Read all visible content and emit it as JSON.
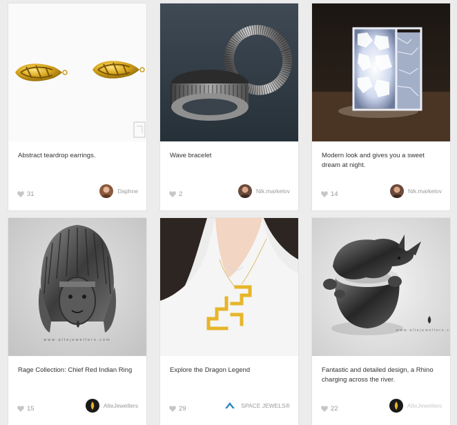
{
  "cards": [
    {
      "title": "Abstract teardrop earrings.",
      "likes": "31",
      "author": "Daphne",
      "avatar_icon": "user-avatar"
    },
    {
      "title": "Wave bracelet",
      "likes": "2",
      "author": "Nik.markelov",
      "avatar_icon": "user-avatar"
    },
    {
      "title": "Modern look and gives you a sweet dream at night.",
      "likes": "14",
      "author": "Nik.markelov",
      "avatar_icon": "user-avatar"
    },
    {
      "title": "Rage Collection: Chief Red Indian Ring",
      "likes": "15",
      "author": "AlteJewellers",
      "avatar_icon": "brand-logo-avatar"
    },
    {
      "title": "Explore the Dragon Legend",
      "likes": "29",
      "author": "SPACE JEWELS®",
      "avatar_icon": "brand-logo-avatar"
    },
    {
      "title": "Fantastic and detailed design, a Rhino charging across the river.",
      "likes": "22",
      "author": "AlteJewellers",
      "avatar_icon": "brand-logo-avatar"
    }
  ],
  "colors": {
    "page_bg": "#ececec",
    "card_bg": "#ffffff",
    "gold": "#d9a81e",
    "muted_text": "#9a9a9a"
  }
}
